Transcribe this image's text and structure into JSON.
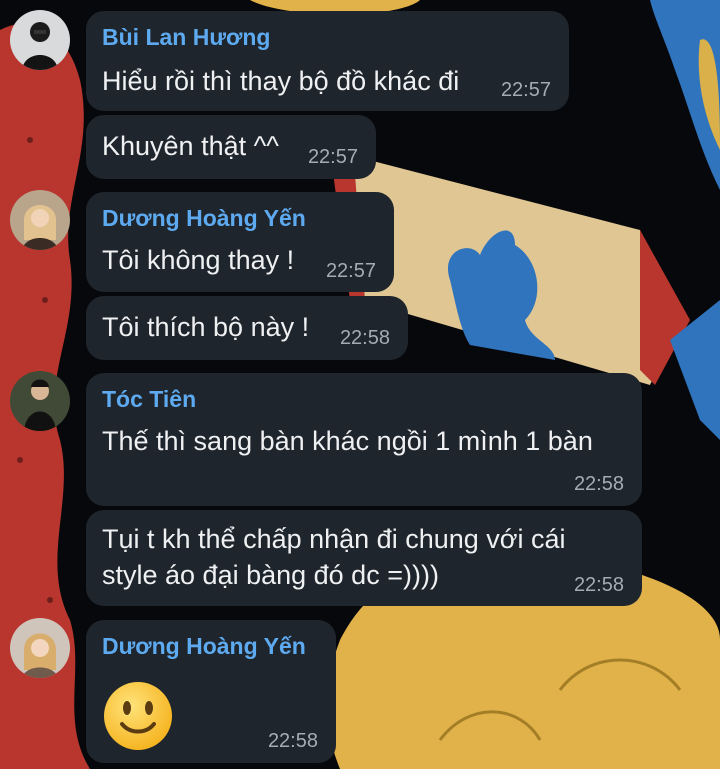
{
  "chat": {
    "messages": [
      {
        "sender": "Bùi Lan Hương",
        "text": "Hiểu rồi thì thay bộ đồ khác đi",
        "time": "22:57"
      },
      {
        "text": "Khuyên thật ^^",
        "time": "22:57"
      },
      {
        "sender": "Dương Hoàng Yến",
        "text": "Tôi không thay !",
        "time": "22:57"
      },
      {
        "text": "Tôi thích bộ này !",
        "time": "22:58"
      },
      {
        "sender": "Tóc Tiên",
        "text": "Thế thì sang bàn khác ngồi 1 mình 1 bàn",
        "time": "22:58"
      },
      {
        "text_lines": [
          "Tụi t kh thể chấp nhận đi chung với cái",
          "style áo đại bàng đó dc =))))"
        ],
        "time": "22:58"
      },
      {
        "sender": "Dương Hoàng Yến",
        "sticker": "slightly-smiling-face-emoji",
        "time": "22:58"
      }
    ]
  },
  "colors": {
    "bubble": "#1f252c",
    "sender_name": "#5eaaf0",
    "timestamp": "#a3acb5",
    "wallpaper": "#07080c"
  }
}
